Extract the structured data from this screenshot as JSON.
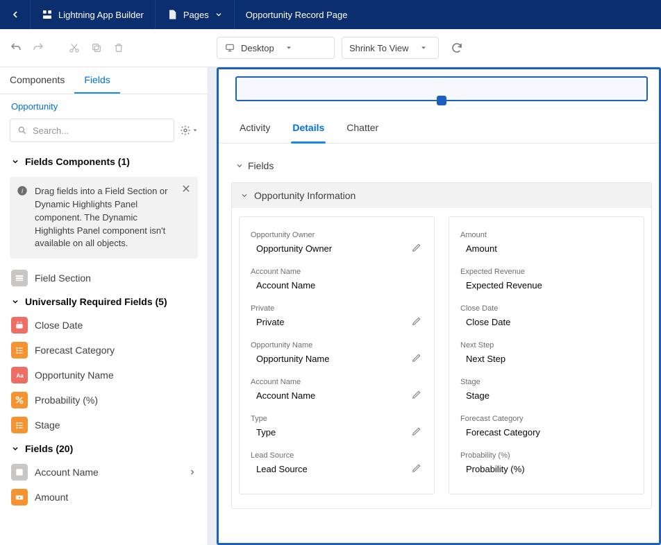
{
  "topbar": {
    "appBuilder": "Lightning App Builder",
    "pages": "Pages",
    "pageTitle": "Opportunity Record Page"
  },
  "toolbar": {
    "device": "Desktop",
    "zoom": "Shrink To View"
  },
  "sidebar": {
    "tabs": {
      "components": "Components",
      "fields": "Fields"
    },
    "breadcrumb": "Opportunity",
    "search": {
      "placeholder": "Search..."
    },
    "fieldsComponents": {
      "heading": "Fields Components (1)",
      "info": "Drag fields into a Field Section or Dynamic Highlights Panel component. The Dynamic Highlights Panel component isn't available on all objects.",
      "items": [
        "Field Section"
      ]
    },
    "requiredFields": {
      "heading": "Universally Required Fields (5)",
      "items": [
        "Close Date",
        "Forecast Category",
        "Opportunity Name",
        "Probability (%)",
        "Stage"
      ]
    },
    "allFields": {
      "heading": "Fields (20)",
      "items": [
        "Account Name",
        "Amount"
      ]
    }
  },
  "canvas": {
    "tabs": {
      "activity": "Activity",
      "details": "Details",
      "chatter": "Chatter"
    },
    "sectionHead": "Fields",
    "oppSection": "Opportunity Information",
    "left": [
      {
        "label": "Opportunity Owner",
        "value": "Opportunity Owner",
        "edit": true
      },
      {
        "label": "Account Name",
        "value": "Account Name",
        "edit": false
      },
      {
        "label": "Private",
        "value": "Private",
        "edit": true
      },
      {
        "label": "Opportunity Name",
        "value": "Opportunity Name",
        "edit": true
      },
      {
        "label": "Account Name",
        "value": "Account Name",
        "edit": true
      },
      {
        "label": "Type",
        "value": "Type",
        "edit": true
      },
      {
        "label": "Lead Source",
        "value": "Lead Source",
        "edit": true
      }
    ],
    "right": [
      {
        "label": "Amount",
        "value": "Amount"
      },
      {
        "label": "Expected Revenue",
        "value": "Expected Revenue"
      },
      {
        "label": "Close Date",
        "value": "Close Date"
      },
      {
        "label": "Next Step",
        "value": "Next Step"
      },
      {
        "label": "Stage",
        "value": "Stage"
      },
      {
        "label": "Forecast Category",
        "value": "Forecast Category"
      },
      {
        "label": "Probability (%)",
        "value": "Probability (%)"
      }
    ]
  }
}
